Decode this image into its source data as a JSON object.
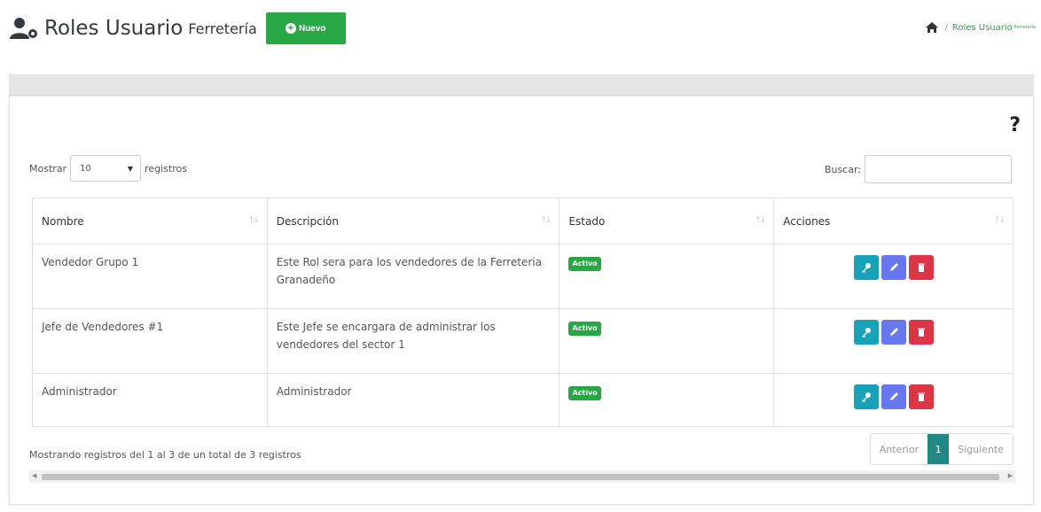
{
  "header": {
    "title": "Roles Usuario",
    "subtitle": "Ferretería",
    "new_button": "Nuevo",
    "breadcrumb": {
      "home_icon": "home-icon",
      "separator": "/",
      "current": "Roles Usuario",
      "current_suffix": "Ferretería"
    }
  },
  "help_label": "?",
  "length_menu": {
    "prefix": "Mostrar",
    "value": "10",
    "suffix": "registros"
  },
  "search": {
    "label": "Buscar:",
    "placeholder": "",
    "value": ""
  },
  "table": {
    "columns": [
      "Nombre",
      "Descripción",
      "Estado",
      "Acciones"
    ],
    "rows": [
      {
        "nombre": "Vendedor Grupo 1",
        "descripcion": "Este Rol sera para los vendedores de la Ferreteria Granadeño",
        "estado": "Activo"
      },
      {
        "nombre": "Jefe de Vendedores #1",
        "descripcion": "Este Jefe se encargara de administrar los vendedores del sector 1",
        "estado": "Activo"
      },
      {
        "nombre": "Administrador",
        "descripcion": "Administrador",
        "estado": "Activo"
      }
    ]
  },
  "footer": {
    "info": "Mostrando registros del 1 al 3 de un total de 3 registros",
    "pager": {
      "prev": "Anterior",
      "current": "1",
      "next": "Siguiente"
    }
  },
  "colors": {
    "success": "#28a745",
    "info": "#17a2b8",
    "primary": "#6777ef",
    "danger": "#dc3545",
    "page_active": "#1f8a84"
  }
}
